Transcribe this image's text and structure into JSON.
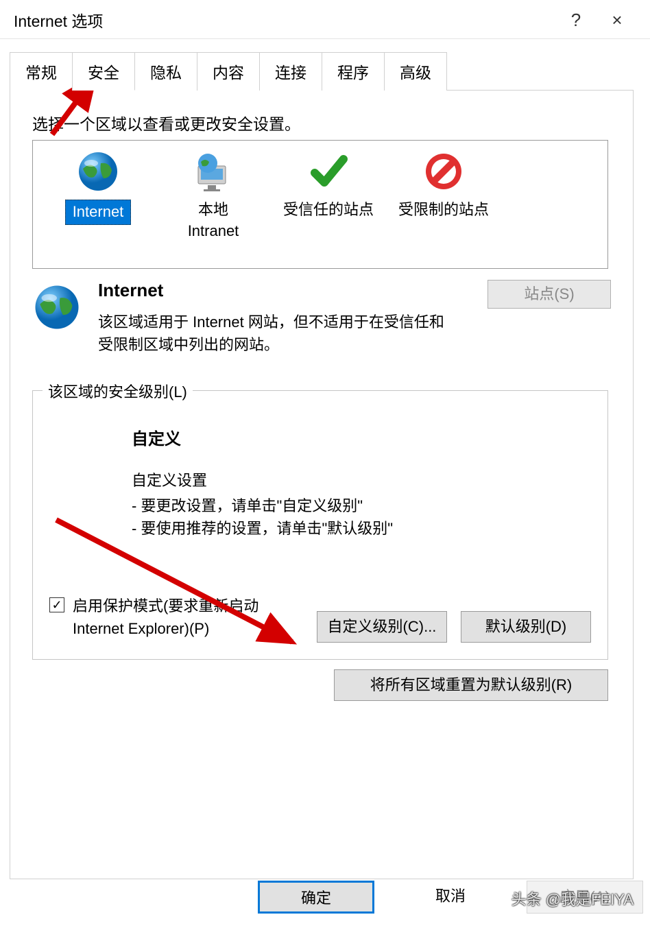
{
  "window": {
    "title": "Internet 选项",
    "help": "?",
    "close": "×"
  },
  "tabs": [
    "常规",
    "安全",
    "隐私",
    "内容",
    "连接",
    "程序",
    "高级"
  ],
  "active_tab_index": 1,
  "zone_section": {
    "label": "选择一个区域以查看或更改安全设置。",
    "zones": [
      {
        "name": "Internet"
      },
      {
        "name": "本地\nIntranet"
      },
      {
        "name": "受信任的站点"
      },
      {
        "name": "受限制的站点"
      }
    ],
    "selected_index": 0
  },
  "current_zone": {
    "name": "Internet",
    "description": "该区域适用于 Internet 网站，但不适用于在受信任和受限制区域中列出的网站。",
    "sites_button": "站点(S)"
  },
  "security_level": {
    "legend": "该区域的安全级别(L)",
    "title": "自定义",
    "subtitle": "自定义设置",
    "line1": "- 要更改设置，请单击\"自定义级别\"",
    "line2": "- 要使用推荐的设置，请单击\"默认级别\"",
    "checkbox_label": "启用保护模式(要求重新启动 Internet Explorer)(P)",
    "checkbox_checked": true,
    "custom_btn": "自定义级别(C)...",
    "default_btn": "默认级别(D)",
    "reset_btn": "将所有区域重置为默认级别(R)"
  },
  "dialog": {
    "ok": "确定",
    "cancel": "取消",
    "apply": "应用(A)"
  },
  "watermark": "头条 @我是FEIYA"
}
